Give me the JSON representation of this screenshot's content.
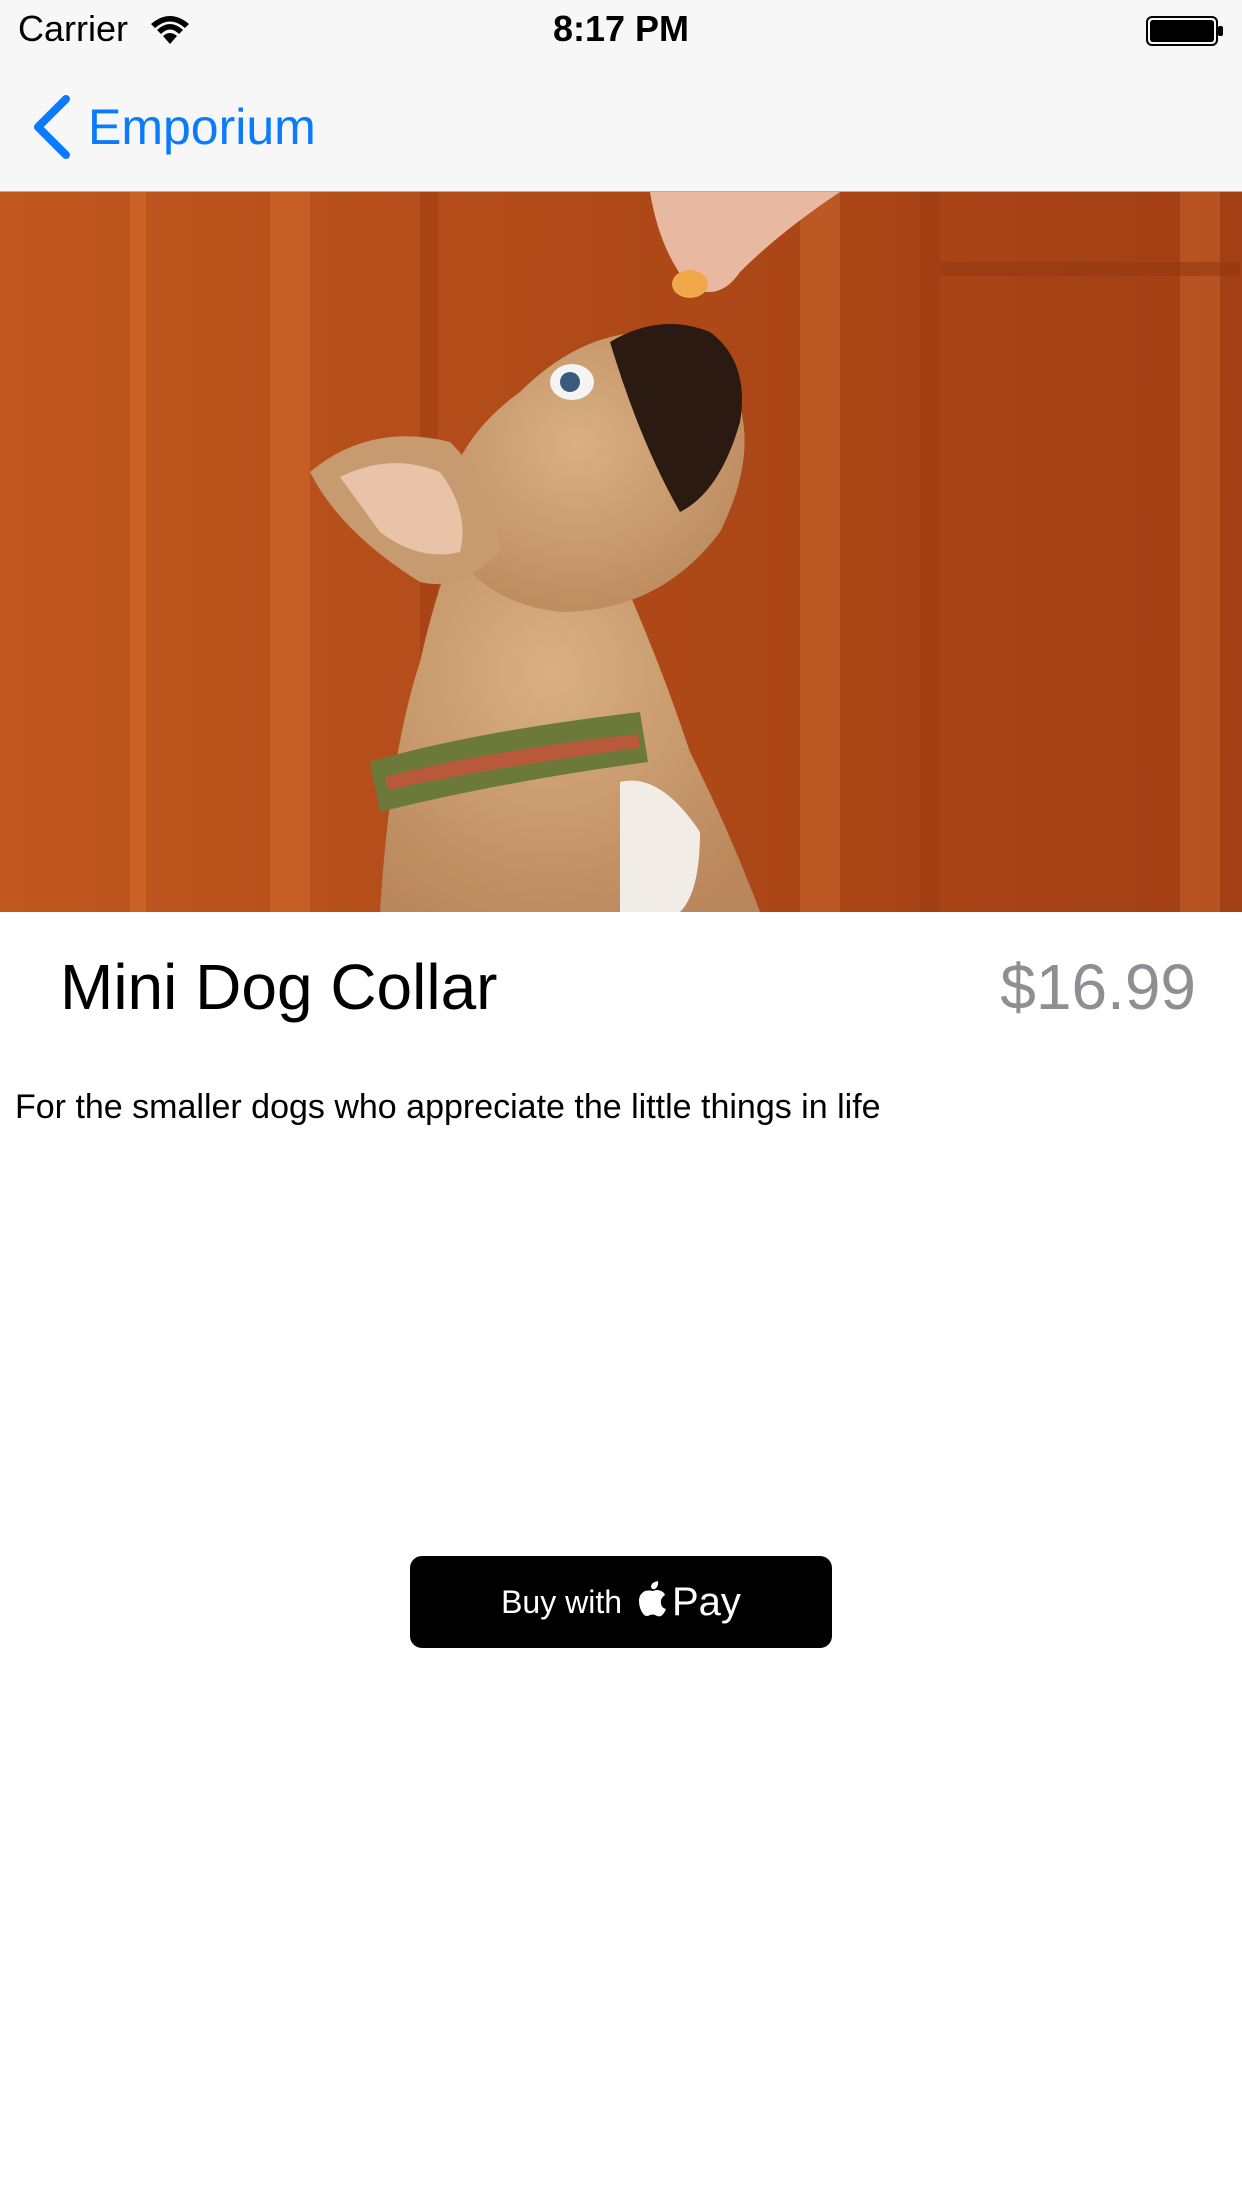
{
  "status_bar": {
    "carrier": "Carrier",
    "time": "8:17 PM",
    "wifi_icon": "wifi-icon",
    "battery_icon": "battery-icon"
  },
  "nav": {
    "back_label": "Emporium",
    "back_icon": "chevron-left-icon",
    "accent_color": "#0a7aff"
  },
  "product": {
    "image": "product-photo",
    "title": "Mini Dog Collar",
    "price": "$16.99",
    "description": "For the smaller dogs who appreciate the little things in life",
    "price_color": "#8e8e93"
  },
  "pay_button": {
    "prefix": "Buy with",
    "pay_word": "Pay",
    "icon": "apple-logo-icon"
  }
}
